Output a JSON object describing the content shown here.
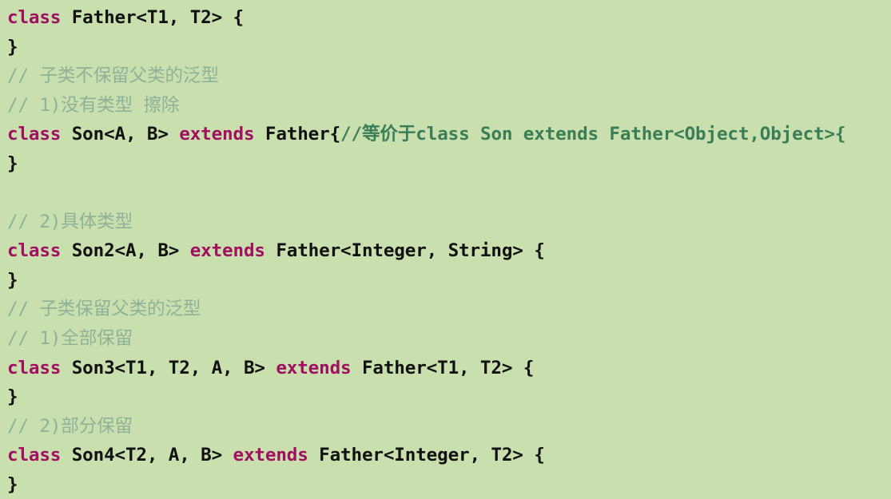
{
  "editor": {
    "language": "java",
    "background_color": "#c9dfae",
    "keyword_color": "#a01060",
    "plain_color": "#111111",
    "comment_color": "#8eb199",
    "inline_comment_color": "#3a7d56",
    "line_count": 15
  },
  "code": {
    "lines": [
      {
        "n": 1,
        "text": "class Father<T1, T2> {",
        "tokens": [
          {
            "t": "class",
            "k": "kw"
          },
          {
            "t": " Father<T1, T2> {",
            "k": "pln"
          }
        ]
      },
      {
        "n": 2,
        "text": "}",
        "tokens": [
          {
            "t": "}",
            "k": "pln"
          }
        ]
      },
      {
        "n": 3,
        "text": "// 子类不保留父类的泛型",
        "tokens": [
          {
            "t": "// 子类不保留父类的泛型",
            "k": "cmt"
          }
        ]
      },
      {
        "n": 4,
        "text": "// 1)没有类型 擦除",
        "tokens": [
          {
            "t": "// 1)没有类型 擦除",
            "k": "cmt"
          }
        ]
      },
      {
        "n": 5,
        "text": "class Son<A, B> extends Father{//等价于class Son extends Father<Object,Object>{",
        "tokens": [
          {
            "t": "class",
            "k": "kw"
          },
          {
            "t": " Son<A, B> ",
            "k": "pln"
          },
          {
            "t": "extends",
            "k": "kw"
          },
          {
            "t": " Father{",
            "k": "pln"
          },
          {
            "t": "//等价于class Son extends Father<Object,Object>{",
            "k": "cmt-inline"
          }
        ]
      },
      {
        "n": 6,
        "text": "}",
        "tokens": [
          {
            "t": "}",
            "k": "pln"
          }
        ]
      },
      {
        "n": 7,
        "text": "",
        "tokens": []
      },
      {
        "n": 8,
        "text": "// 2)具体类型",
        "tokens": [
          {
            "t": "// 2)具体类型",
            "k": "cmt"
          }
        ]
      },
      {
        "n": 9,
        "text": "class Son2<A, B> extends Father<Integer, String> {",
        "tokens": [
          {
            "t": "class",
            "k": "kw"
          },
          {
            "t": " Son2<A, B> ",
            "k": "pln"
          },
          {
            "t": "extends",
            "k": "kw"
          },
          {
            "t": " Father<Integer, String> {",
            "k": "pln"
          }
        ]
      },
      {
        "n": 10,
        "text": "}",
        "tokens": [
          {
            "t": "}",
            "k": "pln"
          }
        ]
      },
      {
        "n": 11,
        "text": "// 子类保留父类的泛型",
        "tokens": [
          {
            "t": "// 子类保留父类的泛型",
            "k": "cmt"
          }
        ]
      },
      {
        "n": 12,
        "text": "// 1)全部保留",
        "tokens": [
          {
            "t": "// 1)全部保留",
            "k": "cmt"
          }
        ]
      },
      {
        "n": 13,
        "text": "class Son3<T1, T2, A, B> extends Father<T1, T2> {",
        "tokens": [
          {
            "t": "class",
            "k": "kw"
          },
          {
            "t": " Son3<T1, T2, A, B> ",
            "k": "pln"
          },
          {
            "t": "extends",
            "k": "kw"
          },
          {
            "t": " Father<T1, T2> {",
            "k": "pln"
          }
        ]
      },
      {
        "n": 14,
        "text": "}",
        "tokens": [
          {
            "t": "}",
            "k": "pln"
          }
        ]
      },
      {
        "n": 15,
        "text": "// 2)部分保留",
        "tokens": [
          {
            "t": "// 2)部分保留",
            "k": "cmt"
          }
        ]
      },
      {
        "n": 16,
        "text": "class Son4<T2, A, B> extends Father<Integer, T2> {",
        "tokens": [
          {
            "t": "class",
            "k": "kw"
          },
          {
            "t": " Son4<T2, A, B> ",
            "k": "pln"
          },
          {
            "t": "extends",
            "k": "kw"
          },
          {
            "t": " Father<Integer, T2> {",
            "k": "pln"
          }
        ]
      },
      {
        "n": 17,
        "text": "}",
        "tokens": [
          {
            "t": "}",
            "k": "pln"
          }
        ]
      }
    ]
  }
}
